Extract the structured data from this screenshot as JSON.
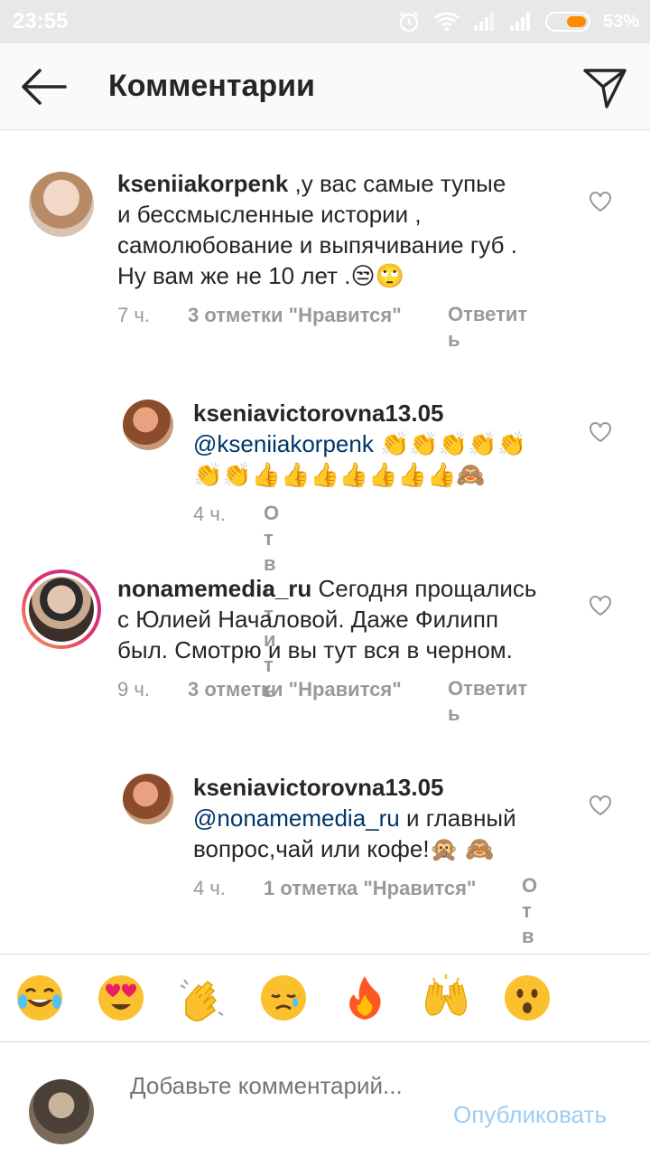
{
  "status": {
    "time": "23:55",
    "battery": "53%",
    "battery_level": 0.53
  },
  "header": {
    "title": "Комментарии"
  },
  "comments": [
    {
      "user": "kseniiakorpenk",
      "text_lines": [
        " ,у вас самые тупые",
        "и бессмысленные истории ,",
        "самолюбование и выпячивание губ .",
        "Ну вам же не 10 лет .😒🙄"
      ],
      "time": "7 ч.",
      "likes": "3 отметки \"Нравится\"",
      "reply": "Ответить"
    },
    {
      "user": "kseniavictorovna13.05",
      "mention": "@kseniiakorpenk",
      "emoji_line1": " 👏👏👏👏👏",
      "emoji_line2": "👏👏👍👍👍👍👍👍👍🙈",
      "time": "4 ч.",
      "reply": "Ответить"
    },
    {
      "user": "nonamemedia_ru",
      "text_lines": [
        " Сегодня прощались",
        "с Юлией Началовой. Даже Филипп",
        "был. Смотрю и вы тут вся в черном."
      ],
      "time": "9 ч.",
      "likes": "3 отметки \"Нравится\"",
      "reply": "Ответить"
    },
    {
      "user": "kseniavictorovna13.05",
      "mention": "@nonamemedia_ru",
      "text_after_mention": " и главный",
      "text_line3": "вопрос,чай или кофе!🙊 🙈",
      "time": "4 ч.",
      "likes": "1 отметка \"Нравится\"",
      "reply": "Ответить"
    }
  ],
  "emoji_bar": [
    "😂",
    "😍",
    "👏",
    "😢",
    "🔥",
    "🙌",
    "😮"
  ],
  "compose": {
    "placeholder": "Добавьте комментарий...",
    "publish": "Опубликовать"
  }
}
